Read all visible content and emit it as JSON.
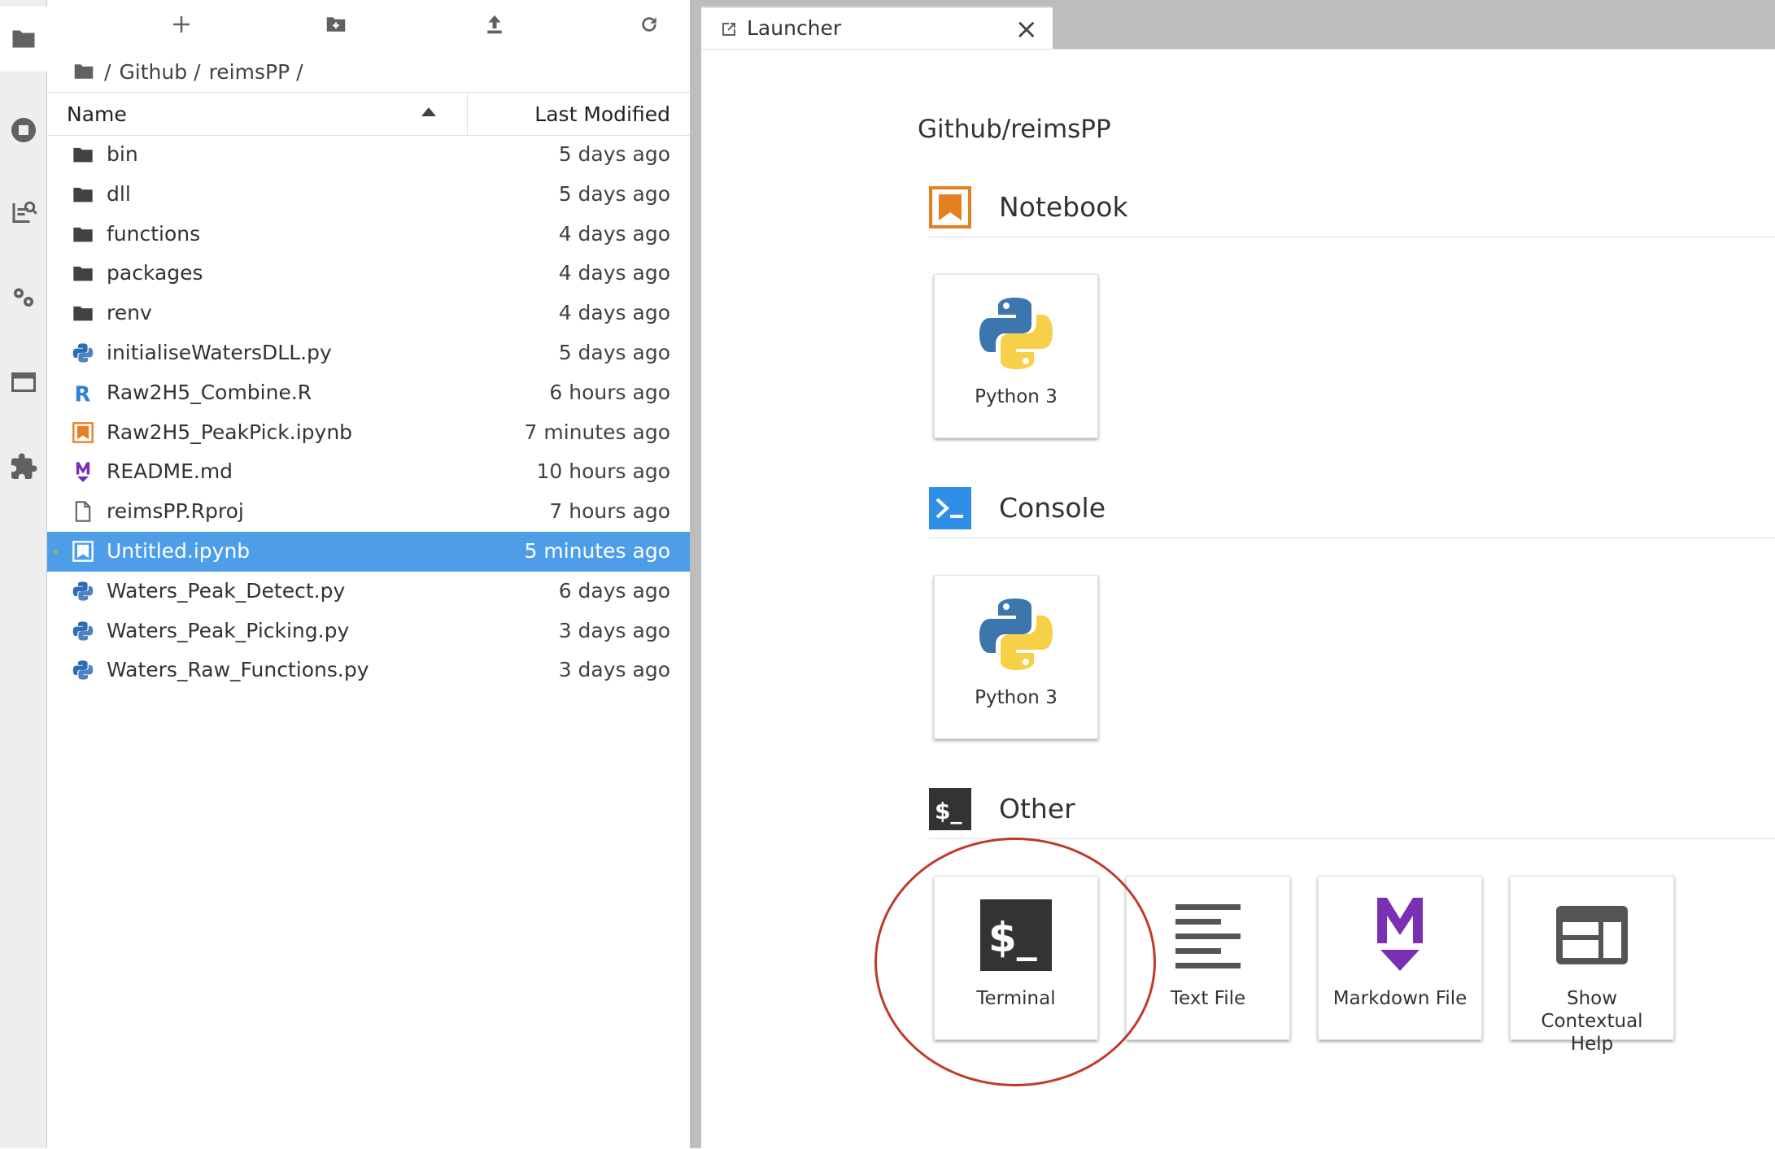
{
  "breadcrumb": {
    "sep": "/",
    "parts": [
      "Github",
      "reimsPP"
    ]
  },
  "file_browser": {
    "columns": {
      "name": "Name",
      "last_modified": "Last Modified"
    },
    "files": [
      {
        "name": "bin",
        "modified": "5 days ago",
        "type": "folder"
      },
      {
        "name": "dll",
        "modified": "5 days ago",
        "type": "folder"
      },
      {
        "name": "functions",
        "modified": "4 days ago",
        "type": "folder"
      },
      {
        "name": "packages",
        "modified": "4 days ago",
        "type": "folder"
      },
      {
        "name": "renv",
        "modified": "4 days ago",
        "type": "folder"
      },
      {
        "name": "initialiseWatersDLL.py",
        "modified": "5 days ago",
        "type": "python"
      },
      {
        "name": "Raw2H5_Combine.R",
        "modified": "6 hours ago",
        "type": "r"
      },
      {
        "name": "Raw2H5_PeakPick.ipynb",
        "modified": "7 minutes ago",
        "type": "notebook"
      },
      {
        "name": "README.md",
        "modified": "10 hours ago",
        "type": "markdown"
      },
      {
        "name": "reimsPP.Rproj",
        "modified": "7 hours ago",
        "type": "file"
      },
      {
        "name": "Untitled.ipynb",
        "modified": "5 minutes ago",
        "type": "notebook",
        "selected": true
      },
      {
        "name": "Waters_Peak_Detect.py",
        "modified": "6 days ago",
        "type": "python"
      },
      {
        "name": "Waters_Peak_Picking.py",
        "modified": "3 days ago",
        "type": "python"
      },
      {
        "name": "Waters_Raw_Functions.py",
        "modified": "3 days ago",
        "type": "python"
      }
    ]
  },
  "tab": {
    "label": "Launcher",
    "close": "×"
  },
  "launcher": {
    "cwd": "Github/reimsPP",
    "notebook": {
      "title": "Notebook",
      "cards": [
        "Python 3"
      ]
    },
    "console": {
      "title": "Console",
      "cards": [
        "Python 3"
      ]
    },
    "other": {
      "title": "Other",
      "cards": [
        "Terminal",
        "Text File",
        "Markdown File",
        "Show Contextual Help"
      ]
    }
  },
  "colors": {
    "selection": "#4d9de9",
    "notebook_orange": "#e67e22",
    "console_blue": "#2f8fe6",
    "markdown_purple": "#7b2fb5",
    "terminal_dark": "#333333",
    "annotation_red": "#c0392b"
  },
  "icons": {
    "activity_bar": [
      "folder-icon",
      "running-icon",
      "commands-icon",
      "property-inspector-icon",
      "tabs-icon",
      "extension-icon"
    ],
    "toolbar": [
      "new-launcher-icon",
      "new-folder-icon",
      "upload-icon",
      "refresh-icon"
    ]
  }
}
